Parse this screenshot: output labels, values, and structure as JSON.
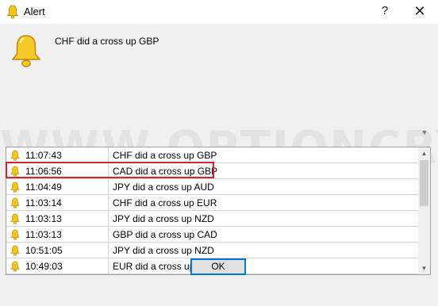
{
  "window": {
    "title": "Alert",
    "help_glyph": "?",
    "close_glyph": "✕"
  },
  "message": "CHF did a cross up GBP",
  "icons": {
    "title": "bell-icon",
    "alert": "bell-icon",
    "row": "bell-icon"
  },
  "colors": {
    "bell_fill": "#f5c518",
    "bell_outline": "#c8960c",
    "highlight_border": "#d9232b",
    "ok_border": "#0078d7"
  },
  "watermark": "WWW.OPTIONCRYPTO.COM",
  "alerts": [
    {
      "time": "11:07:43",
      "message": "CHF did a cross up GBP"
    },
    {
      "time": "11:06:56",
      "message": "CAD did a cross up GBP"
    },
    {
      "time": "11:04:49",
      "message": "JPY did a cross up AUD"
    },
    {
      "time": "11:03:14",
      "message": "CHF did a cross up EUR"
    },
    {
      "time": "11:03:13",
      "message": "JPY did a cross up NZD"
    },
    {
      "time": "11:03:13",
      "message": "GBP did a cross up CAD"
    },
    {
      "time": "10:51:05",
      "message": "JPY did a cross up NZD"
    },
    {
      "time": "10:49:03",
      "message": "EUR did a cross up CAD"
    }
  ],
  "buttons": {
    "ok": "OK"
  }
}
